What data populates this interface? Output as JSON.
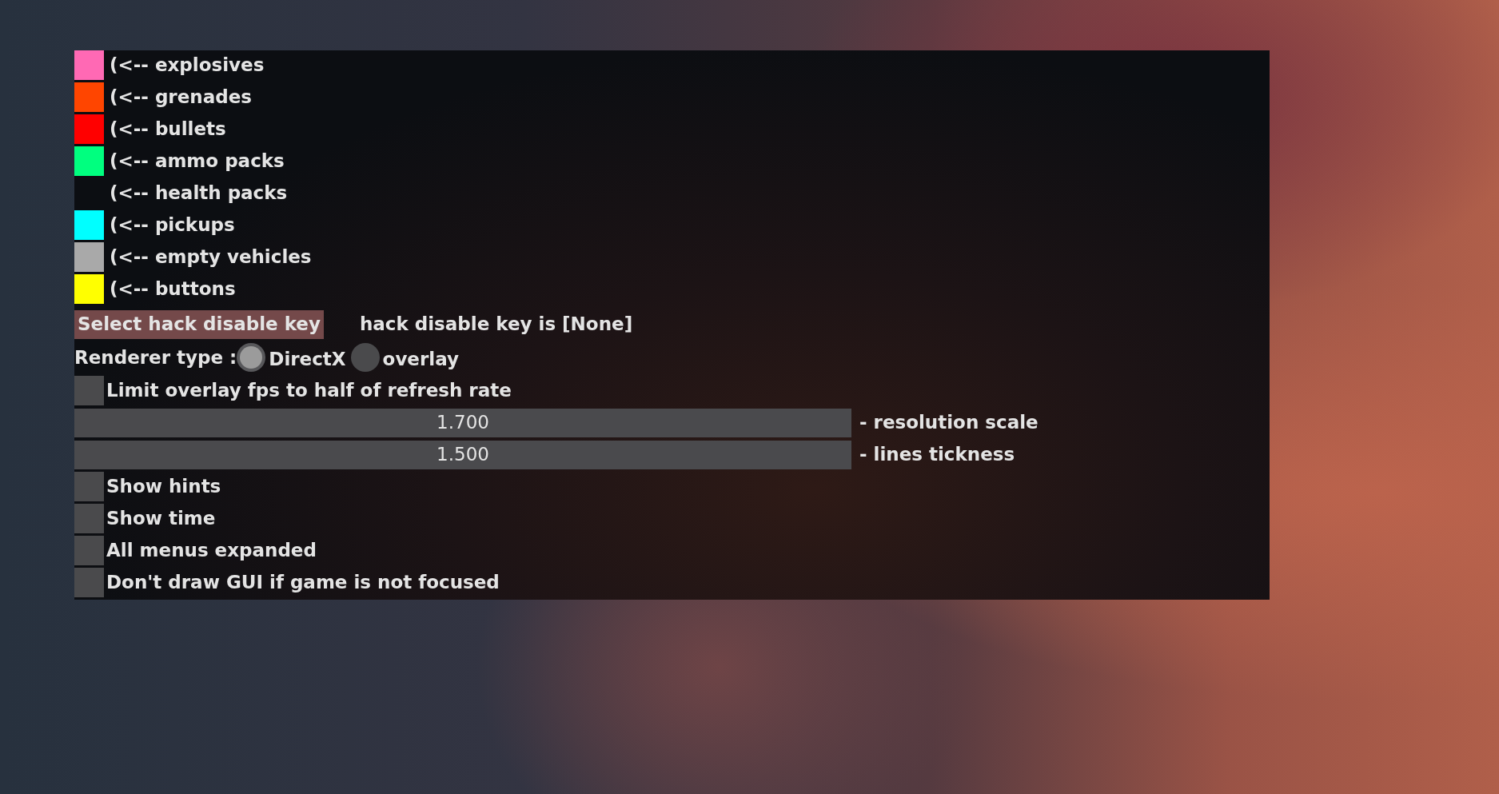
{
  "legend": [
    {
      "label": "(<-- explosives",
      "color": "#ff69b4"
    },
    {
      "label": "(<-- grenades",
      "color": "#ff4500"
    },
    {
      "label": "(<-- bullets",
      "color": "#ff0000"
    },
    {
      "label": "(<-- ammo packs",
      "color": "#00ff7f"
    },
    {
      "label": "(<-- health packs"
    },
    {
      "label": "(<-- pickups",
      "color": "#00ffff"
    },
    {
      "label": "(<-- empty vehicles",
      "color": "#a9a9a9"
    },
    {
      "label": "(<-- buttons",
      "color": "#ffff00"
    }
  ],
  "hack_disable": {
    "button": "Select hack disable key",
    "status": "hack disable key is [None]"
  },
  "renderer": {
    "label": "Renderer type :",
    "options": [
      {
        "label": "DirectX",
        "selected": true
      },
      {
        "label": "overlay",
        "selected": false
      }
    ]
  },
  "controls": [
    {
      "kind": "checkbox",
      "label": "Limit overlay fps to half of refresh rate",
      "checked": false
    },
    {
      "kind": "slider",
      "reading": "1.700",
      "label": "- resolution scale"
    },
    {
      "kind": "slider",
      "reading": "1.500",
      "label": "- lines tickness"
    },
    {
      "kind": "checkbox",
      "label": "Show hints",
      "checked": false
    },
    {
      "kind": "checkbox",
      "label": "Show time",
      "checked": false
    },
    {
      "kind": "checkbox",
      "label": "All menus expanded",
      "checked": false
    },
    {
      "kind": "checkbox",
      "label": "Don't draw GUI if game is not focused",
      "checked": false
    }
  ]
}
